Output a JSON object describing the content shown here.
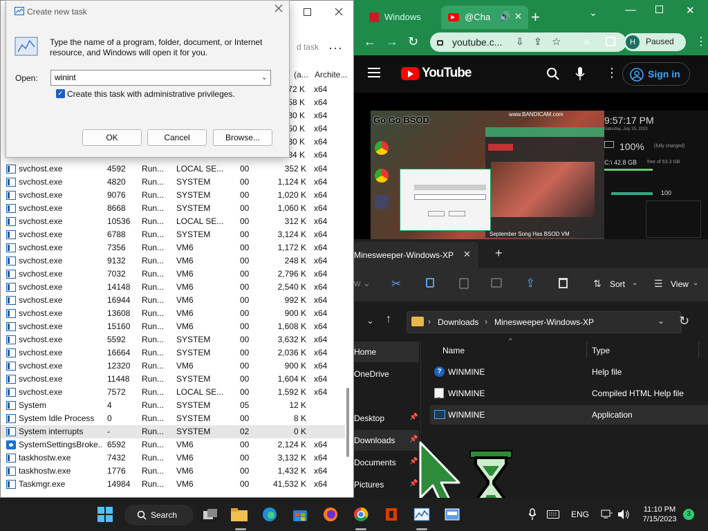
{
  "task_manager": {
    "toolbar_partial": "d task",
    "columns": {
      "pid_partial": "(a...",
      "arch": "Archite..."
    },
    "partial_rows": [
      {
        "mem": "72 K",
        "arch": "x64"
      },
      {
        "mem": "58 K",
        "arch": "x64"
      },
      {
        "mem": "30 K",
        "arch": "x64"
      },
      {
        "mem": "50 K",
        "arch": "x64"
      },
      {
        "mem": "30 K",
        "arch": "x64"
      },
      {
        "mem": "84 K",
        "arch": "x64"
      }
    ],
    "rows": [
      {
        "name": "svchost.exe",
        "pid": "4592",
        "status": "Run...",
        "user": "LOCAL SE...",
        "cpu": "00",
        "mem": "352 K",
        "arch": "x64"
      },
      {
        "name": "svchost.exe",
        "pid": "4820",
        "status": "Run...",
        "user": "SYSTEM",
        "cpu": "00",
        "mem": "1,124 K",
        "arch": "x64"
      },
      {
        "name": "svchost.exe",
        "pid": "9076",
        "status": "Run...",
        "user": "SYSTEM",
        "cpu": "00",
        "mem": "1,020 K",
        "arch": "x64"
      },
      {
        "name": "svchost.exe",
        "pid": "8668",
        "status": "Run...",
        "user": "SYSTEM",
        "cpu": "00",
        "mem": "1,060 K",
        "arch": "x64"
      },
      {
        "name": "svchost.exe",
        "pid": "10536",
        "status": "Run...",
        "user": "LOCAL SE...",
        "cpu": "00",
        "mem": "312 K",
        "arch": "x64"
      },
      {
        "name": "svchost.exe",
        "pid": "6788",
        "status": "Run...",
        "user": "SYSTEM",
        "cpu": "00",
        "mem": "3,124 K",
        "arch": "x64"
      },
      {
        "name": "svchost.exe",
        "pid": "7356",
        "status": "Run...",
        "user": "VM6",
        "cpu": "00",
        "mem": "1,172 K",
        "arch": "x64"
      },
      {
        "name": "svchost.exe",
        "pid": "9132",
        "status": "Run...",
        "user": "VM6",
        "cpu": "00",
        "mem": "248 K",
        "arch": "x64"
      },
      {
        "name": "svchost.exe",
        "pid": "7032",
        "status": "Run...",
        "user": "VM6",
        "cpu": "00",
        "mem": "2,796 K",
        "arch": "x64"
      },
      {
        "name": "svchost.exe",
        "pid": "14148",
        "status": "Run...",
        "user": "VM6",
        "cpu": "00",
        "mem": "2,540 K",
        "arch": "x64"
      },
      {
        "name": "svchost.exe",
        "pid": "16944",
        "status": "Run...",
        "user": "VM6",
        "cpu": "00",
        "mem": "992 K",
        "arch": "x64"
      },
      {
        "name": "svchost.exe",
        "pid": "13608",
        "status": "Run...",
        "user": "VM6",
        "cpu": "00",
        "mem": "900 K",
        "arch": "x64"
      },
      {
        "name": "svchost.exe",
        "pid": "15160",
        "status": "Run...",
        "user": "VM6",
        "cpu": "00",
        "mem": "1,608 K",
        "arch": "x64"
      },
      {
        "name": "svchost.exe",
        "pid": "5592",
        "status": "Run...",
        "user": "SYSTEM",
        "cpu": "00",
        "mem": "3,632 K",
        "arch": "x64"
      },
      {
        "name": "svchost.exe",
        "pid": "16664",
        "status": "Run...",
        "user": "SYSTEM",
        "cpu": "00",
        "mem": "2,036 K",
        "arch": "x64"
      },
      {
        "name": "svchost.exe",
        "pid": "12320",
        "status": "Run...",
        "user": "VM6",
        "cpu": "00",
        "mem": "900 K",
        "arch": "x64"
      },
      {
        "name": "svchost.exe",
        "pid": "11448",
        "status": "Run...",
        "user": "SYSTEM",
        "cpu": "00",
        "mem": "1,604 K",
        "arch": "x64"
      },
      {
        "name": "svchost.exe",
        "pid": "7572",
        "status": "Run...",
        "user": "LOCAL SE...",
        "cpu": "00",
        "mem": "1,592 K",
        "arch": "x64"
      },
      {
        "name": "System",
        "pid": "4",
        "status": "Run...",
        "user": "SYSTEM",
        "cpu": "05",
        "mem": "12 K",
        "arch": ""
      },
      {
        "name": "System Idle Process",
        "pid": "0",
        "status": "Run...",
        "user": "SYSTEM",
        "cpu": "00",
        "mem": "8 K",
        "arch": ""
      },
      {
        "name": "System interrupts",
        "pid": "-",
        "status": "Run...",
        "user": "SYSTEM",
        "cpu": "02",
        "mem": "0 K",
        "arch": ""
      },
      {
        "name": "SystemSettingsBroke...",
        "pid": "6592",
        "status": "Run...",
        "user": "VM6",
        "cpu": "00",
        "mem": "2,124 K",
        "arch": "x64"
      },
      {
        "name": "taskhostw.exe",
        "pid": "7432",
        "status": "Run...",
        "user": "VM6",
        "cpu": "00",
        "mem": "3,132 K",
        "arch": "x64"
      },
      {
        "name": "taskhostw.exe",
        "pid": "1776",
        "status": "Run...",
        "user": "VM6",
        "cpu": "00",
        "mem": "1,432 K",
        "arch": "x64"
      },
      {
        "name": "Taskmgr.exe",
        "pid": "14984",
        "status": "Run...",
        "user": "VM6",
        "cpu": "00",
        "mem": "41,532 K",
        "arch": "x64"
      }
    ]
  },
  "run_dialog": {
    "title": "Create new task",
    "description": "Type the name of a program, folder, document, or Internet resource, and Windows will open it for you.",
    "open_label": "Open:",
    "open_value": "winint",
    "checkbox_label": "Create this task with administrative privileges.",
    "ok": "OK",
    "cancel": "Cancel",
    "browse": "Browse..."
  },
  "chrome": {
    "tab1": "Windows",
    "tab2": "@Cha",
    "url": "youtube.c...",
    "profile_initial": "H",
    "profile_status": "Paused",
    "yt_logo": "YouTube",
    "sign_in": "Sign in",
    "video": {
      "clock": "9:57:17 PM",
      "date": "Saturday, July 15, 2023",
      "battery": "100%",
      "battery_status": "(fully charged)",
      "disk": "C:\\ 42.8 GB",
      "disk_free": "free of 63.3 GB",
      "caption": "September Song Has BSOD VM",
      "overlay_title": "Go Go BSOD",
      "bandicam": "www.BANDICAM.com",
      "meter_value": "100"
    }
  },
  "explorer": {
    "tab_title": "Minesweeper-Windows-XP",
    "toolbar": {
      "sort": "Sort",
      "view": "View"
    },
    "breadcrumb": [
      "Downloads",
      "Minesweeper-Windows-XP"
    ],
    "columns": {
      "name": "Name",
      "type": "Type"
    },
    "nav": [
      {
        "label": "Home"
      },
      {
        "label": "OneDrive"
      },
      {
        "label": "Desktop"
      },
      {
        "label": "Downloads"
      },
      {
        "label": "Documents"
      },
      {
        "label": "Pictures"
      }
    ],
    "files": [
      {
        "name": "WINMINE",
        "type": "Help file"
      },
      {
        "name": "WINMINE",
        "type": "Compiled HTML Help file"
      },
      {
        "name": "WINMINE",
        "type": "Application"
      }
    ]
  },
  "taskbar": {
    "search": "Search",
    "lang": "ENG",
    "time": "11:10 PM",
    "date": "7/15/2023",
    "badge": "3"
  },
  "colors": {
    "taskbar_bg": "#1e1e1e",
    "chrome_frame": "#1f8a4a",
    "accent_blue": "#1a62c2",
    "youtube_red": "#ff0000",
    "cursor_green": "#2e8b3a"
  }
}
